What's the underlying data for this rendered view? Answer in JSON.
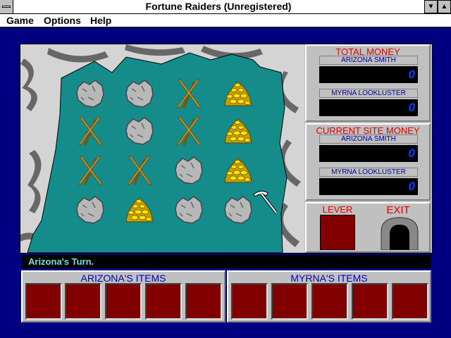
{
  "window": {
    "title": "Fortune Raiders (Unregistered)"
  },
  "menu": [
    {
      "label": "Game"
    },
    {
      "label": "Options"
    },
    {
      "label": "Help"
    }
  ],
  "board": {
    "rows": [
      [
        "rock-icon",
        "rock-icon",
        "pickaxe-bundle-icon",
        "gold-pile-icon"
      ],
      [
        "pickaxe-bundle-icon",
        "rock-icon",
        "pickaxe-bundle-icon",
        "gold-pile-icon"
      ],
      [
        "pickaxe-bundle-icon",
        "pickaxe-bundle-icon",
        "rock-icon",
        "gold-pile-icon"
      ],
      [
        "rock-icon",
        "gold-pile-icon",
        "rock-icon",
        "rock-icon"
      ]
    ],
    "cursor": "pickaxe-cursor-icon"
  },
  "total_money": {
    "heading": "TOTAL MONEY",
    "players": [
      {
        "name": "ARIZONA SMITH",
        "value": "0"
      },
      {
        "name": "MYRNA LOOKLUSTER",
        "value": "0"
      }
    ]
  },
  "site_money": {
    "heading": "CURRENT SITE MONEY",
    "players": [
      {
        "name": "ARIZONA SMITH",
        "value": "0"
      },
      {
        "name": "MYRNA LOOKLUSTER",
        "value": "0"
      }
    ]
  },
  "controls": {
    "lever_label": "LEVER",
    "exit_label": "EXIT"
  },
  "status": "Arizona's Turn.",
  "items": {
    "arizona_label": "ARIZONA'S ITEMS",
    "myrna_label": "MYRNA'S ITEMS",
    "slot_count": 5
  },
  "colors": {
    "desktop": "#000080",
    "cave_floor": "#148c8c",
    "slot": "#800000",
    "heading_red": "#e00000"
  }
}
